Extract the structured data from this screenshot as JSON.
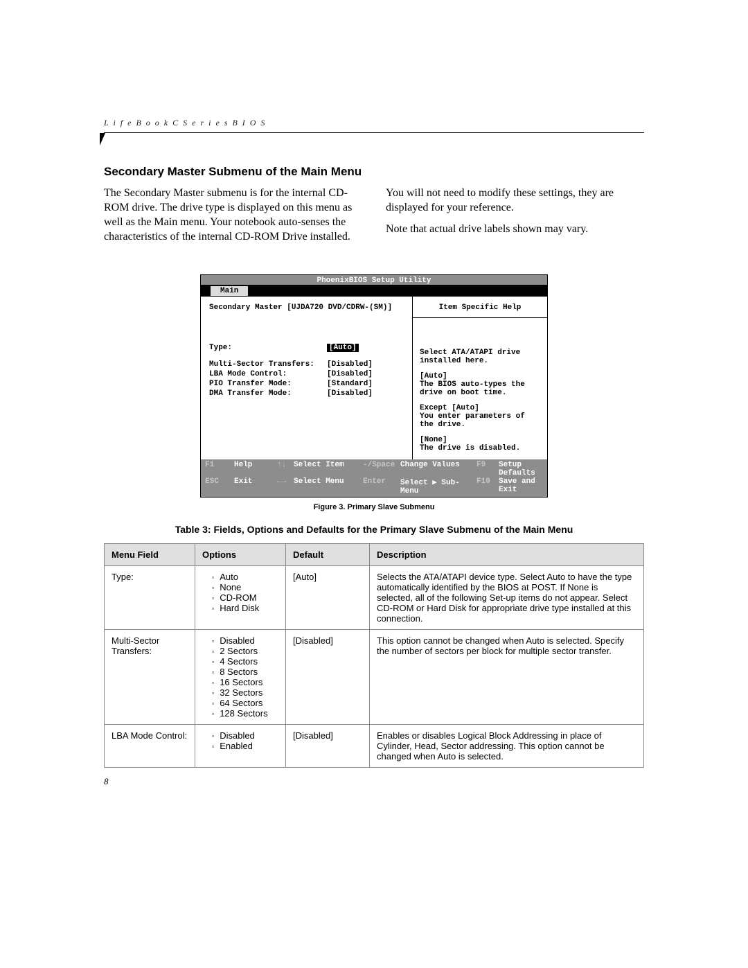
{
  "header": {
    "running": "L i f e B o o k   C   S e r i e s   B I O S"
  },
  "section": {
    "title": "Secondary Master Submenu of the Main Menu",
    "col1_p1": "The Secondary Master submenu is for the internal CD-ROM drive. The drive type is displayed on this menu as well as the Main menu. Your notebook auto-senses the characteristics of the internal CD-ROM Drive installed.",
    "col2_p1": "You will not need to modify these settings, they are displayed for your reference.",
    "col2_p2": "Note that actual drive labels shown may vary."
  },
  "bios": {
    "title": "PhoenixBIOS Setup Utility",
    "tab": "Main",
    "breadcrumb": "Secondary Master [UJDA720 DVD/CDRW-(SM)]",
    "help_title": "Item Specific Help",
    "fields": {
      "type_label": "Type:",
      "type_value": "[Auto]",
      "mst_label": "Multi-Sector Transfers:",
      "mst_value": "[Disabled]",
      "lba_label": "LBA Mode Control:",
      "lba_value": "[Disabled]",
      "pio_label": "PIO Transfer Mode:",
      "pio_value": "[Standard]",
      "dma_label": "DMA Transfer Mode:",
      "dma_value": "[Disabled]"
    },
    "help_text": {
      "l1": "Select ATA/ATAPI drive",
      "l2": "installed here.",
      "l3": "[Auto]",
      "l4": "The BIOS auto-types the",
      "l5": "drive on boot time.",
      "l6": "Except [Auto]",
      "l7": "You enter parameters of",
      "l8": "the drive.",
      "l9": "[None]",
      "l10": "The drive is disabled."
    },
    "footer": {
      "f1": "F1",
      "help": "Help",
      "ud": "↑↓",
      "sel_item": "Select Item",
      "ms": "-/Space",
      "ch_vals": "Change Values",
      "f9": "F9",
      "setup_def": "Setup Defaults",
      "esc": "ESC",
      "exit": "Exit",
      "lr": "←→",
      "sel_menu": "Select Menu",
      "enter": "Enter",
      "sel_sub": "Select ▶ Sub-Menu",
      "f10": "F10",
      "save_exit": "Save and Exit"
    }
  },
  "figure_caption": "Figure 3.  Primary Slave Submenu",
  "table_title": "Table 3: Fields, Options and Defaults for the Primary Slave Submenu of the Main Menu",
  "table": {
    "headers": {
      "menu_field": "Menu Field",
      "options": "Options",
      "default": "Default",
      "description": "Description"
    },
    "rows": [
      {
        "field": "Type:",
        "options": [
          "Auto",
          "None",
          "CD-ROM",
          "Hard Disk"
        ],
        "default": "[Auto]",
        "desc": "Selects the ATA/ATAPI device type. Select Auto to have the type automatically identified by the BIOS at POST. If None is selected, all of the following Set-up items do not appear. Select CD-ROM or Hard Disk for appropriate drive type installed at this connection."
      },
      {
        "field": "Multi-Sector Transfers:",
        "options": [
          "Disabled",
          "2 Sectors",
          "4 Sectors",
          "8 Sectors",
          "16 Sectors",
          "32 Sectors",
          "64 Sectors",
          "128 Sectors"
        ],
        "default": "[Disabled]",
        "desc": "This option cannot be changed when Auto is selected. Specify the number of sectors per block for multiple sector transfer."
      },
      {
        "field": "LBA Mode Control:",
        "options": [
          "Disabled",
          "Enabled"
        ],
        "default": "[Disabled]",
        "desc": "Enables or disables Logical Block Addressing in place of Cylinder, Head, Sector addressing. This option cannot be changed when Auto is selected."
      }
    ]
  },
  "page_number": "8"
}
